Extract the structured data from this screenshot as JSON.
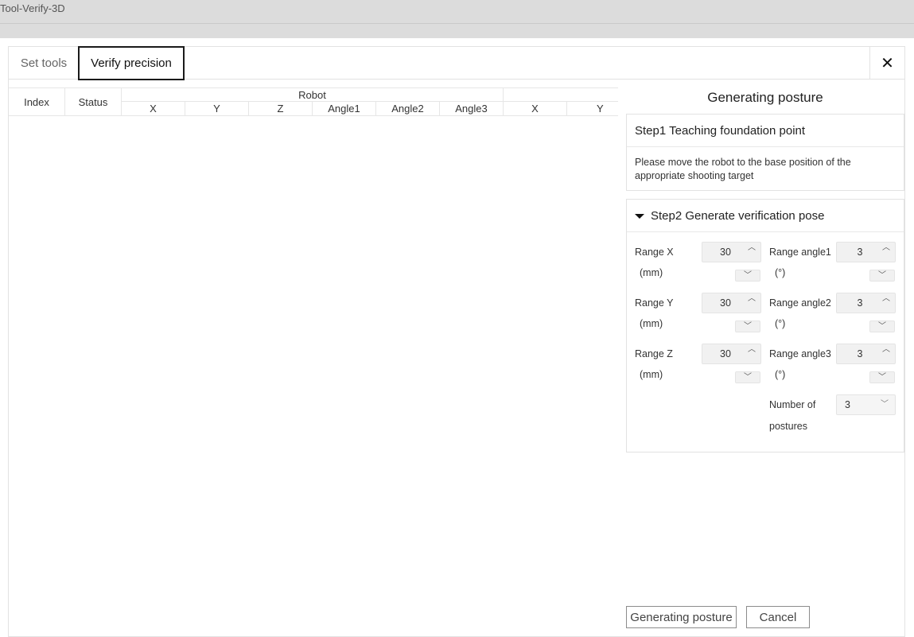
{
  "window": {
    "title": "Tool-Verify-3D"
  },
  "tabs": [
    {
      "label": "Set tools"
    },
    {
      "label": "Verify precision"
    }
  ],
  "close_glyph": "✕",
  "table": {
    "fixed_columns": [
      "Index",
      "Status"
    ],
    "group_label": "Robot",
    "robot_columns": [
      "X",
      "Y",
      "Z",
      "Angle1",
      "Angle2",
      "Angle3"
    ],
    "second_group_columns": [
      "X",
      "Y"
    ]
  },
  "right": {
    "title": "Generating posture",
    "step1": {
      "title": "Step1 Teaching foundation point",
      "text": "Please move the robot to the base position of the appropriate shooting target"
    },
    "step2": {
      "title": "Step2 Generate verification pose",
      "fields": [
        {
          "label": "Range X",
          "unit": "(mm)",
          "value": "30"
        },
        {
          "label": "Range angle1",
          "unit": "(°)",
          "value": "3"
        },
        {
          "label": "Range Y",
          "unit": "(mm)",
          "value": "30"
        },
        {
          "label": "Range angle2",
          "unit": "(°)",
          "value": "3"
        },
        {
          "label": "Range Z",
          "unit": "(mm)",
          "value": "30"
        },
        {
          "label": "Range angle3",
          "unit": "(°)",
          "value": "3"
        }
      ],
      "postures": {
        "label_line1": "Number of",
        "label_line2": "postures",
        "value": "3"
      }
    }
  },
  "buttons": {
    "generate": "Generating posture",
    "cancel": "Cancel"
  }
}
